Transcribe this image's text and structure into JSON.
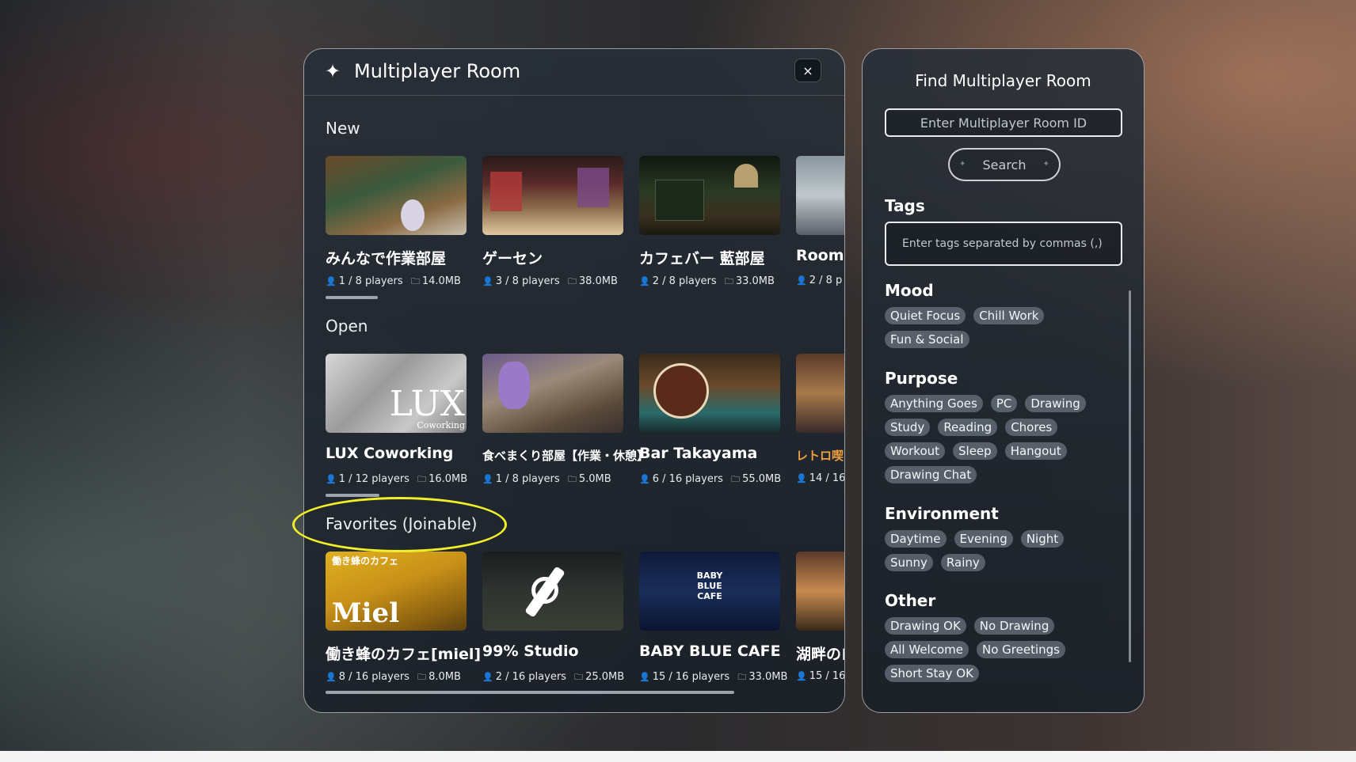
{
  "main": {
    "title": "Multiplayer Room",
    "close_label": "×",
    "sections": [
      {
        "title": "New",
        "rooms": [
          {
            "name": "みんなで作業部屋",
            "players": "1 / 8 players",
            "size": "14.0MB"
          },
          {
            "name": "ゲーセン",
            "players": "3 / 8 players",
            "size": "38.0MB"
          },
          {
            "name": "カフェバー 藍部屋",
            "players": "2 / 8 players",
            "size": "33.0MB"
          },
          {
            "name": "Room",
            "players": "2 / 8 p",
            "size": ""
          }
        ]
      },
      {
        "title": "Open",
        "rooms": [
          {
            "name": "LUX Coworking",
            "players": "1 / 12 players",
            "size": "16.0MB"
          },
          {
            "name": "食べまくり部屋【作業・休憩】",
            "players": "1 / 8 players",
            "size": "5.0MB"
          },
          {
            "name": "Bar Takayama",
            "players": "6 / 16 players",
            "size": "55.0MB"
          },
          {
            "name": "レトロ喫",
            "players": "14 / 16",
            "size": ""
          }
        ]
      },
      {
        "title": "Favorites (Joinable)",
        "rooms": [
          {
            "name": "働き蜂のカフェ[miel]",
            "players": "8 / 16 players",
            "size": "8.0MB"
          },
          {
            "name": "99% Studio",
            "players": "2 / 16 players",
            "size": "25.0MB"
          },
          {
            "name": "BABY BLUE CAFE",
            "players": "15 / 16 players",
            "size": "33.0MB"
          },
          {
            "name": "湖畔のロ",
            "players": "15 / 16",
            "size": ""
          }
        ]
      }
    ],
    "thumb_texts": {
      "lux": "LUX",
      "lux_sub": "Coworking",
      "miel": "Miel",
      "miel_top": "働き蜂のカフェ",
      "baby_blue": "BABY BLUE CAFE"
    }
  },
  "find": {
    "title": "Find Multiplayer Room",
    "room_id_placeholder": "Enter Multiplayer Room ID",
    "search_label": "Search",
    "tags_heading": "Tags",
    "tags_placeholder": "Enter tags separated by commas (,)",
    "groups": [
      {
        "title": "Mood",
        "tags": [
          "Quiet Focus",
          "Chill Work",
          "Fun & Social"
        ]
      },
      {
        "title": "Purpose",
        "tags": [
          "Anything Goes",
          "PC",
          "Drawing",
          "Study",
          "Reading",
          "Chores",
          "Workout",
          "Sleep",
          "Hangout",
          "Drawing Chat"
        ]
      },
      {
        "title": "Environment",
        "tags": [
          "Daytime",
          "Evening",
          "Night",
          "Sunny",
          "Rainy"
        ]
      },
      {
        "title": "Other",
        "tags": [
          "Drawing OK",
          "No Drawing",
          "All Welcome",
          "No Greetings",
          "Short Stay OK"
        ]
      }
    ]
  },
  "colors": {
    "highlight": "#f1ee2a",
    "chip_bg": "#6e7884",
    "panel_border": "#ffffff"
  }
}
